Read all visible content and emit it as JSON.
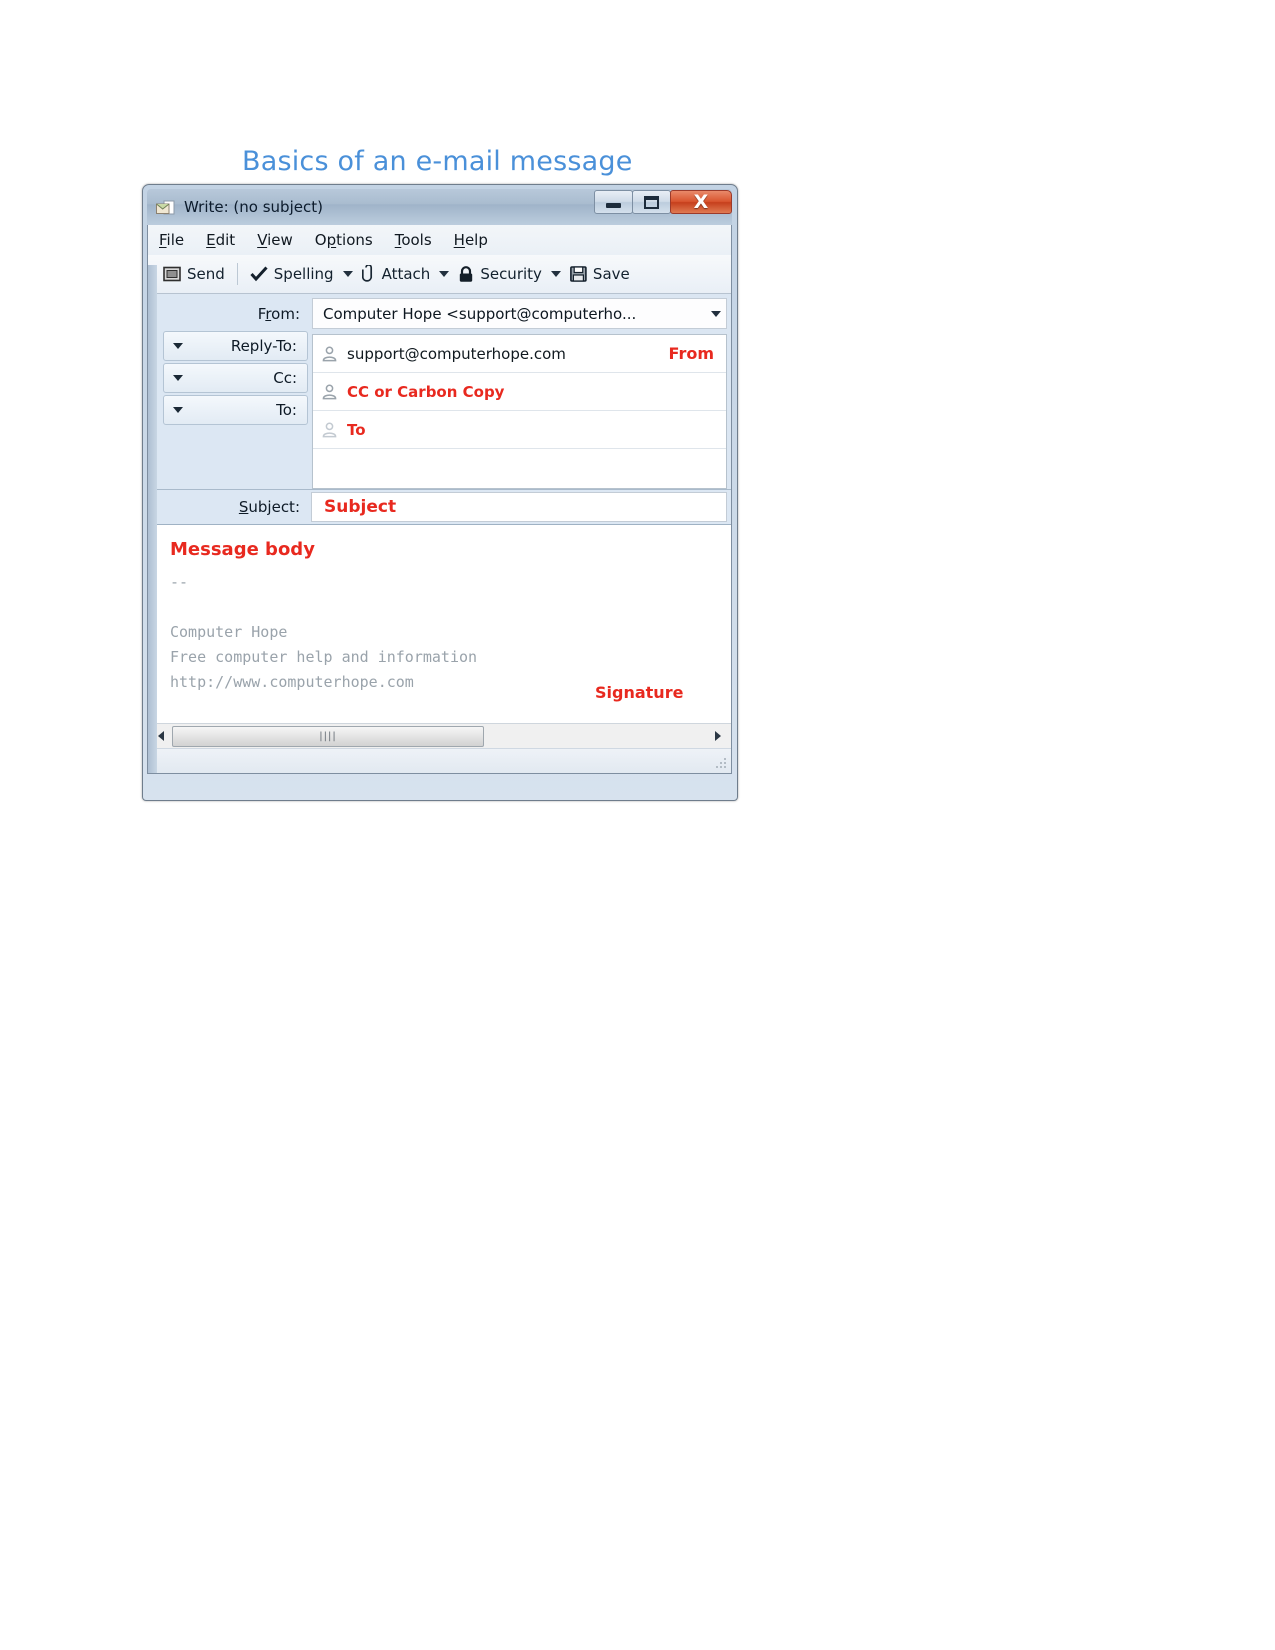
{
  "page": {
    "heading": "Basics of an e-mail message",
    "heading_color": "#4a90d9",
    "annotation_color": "#e8291f"
  },
  "window": {
    "title": "Write: (no subject)",
    "icon": "compose-mail-icon",
    "buttons": {
      "minimize": "Minimize",
      "maximize": "Maximize",
      "close": "X"
    }
  },
  "menu": {
    "items": [
      {
        "label": "File",
        "accel": "F"
      },
      {
        "label": "Edit",
        "accel": "E"
      },
      {
        "label": "View",
        "accel": "V"
      },
      {
        "label": "Options",
        "accel": "p"
      },
      {
        "label": "Tools",
        "accel": "T"
      },
      {
        "label": "Help",
        "accel": "H"
      }
    ]
  },
  "toolbar": {
    "send_label": "Send",
    "spelling_label": "Spelling",
    "attach_label": "Attach",
    "security_label": "Security",
    "save_label": "Save"
  },
  "headers": {
    "from_label": "From:",
    "from_value": "Computer Hope <support@computerho...",
    "reply_to_label": "Reply-To:",
    "cc_label": "Cc:",
    "to_label": "To:",
    "subject_label": "Subject:",
    "subject_value": "Subject",
    "rows": [
      {
        "value": "support@computerhope.com",
        "annotated": false,
        "annotation": "From"
      },
      {
        "value": "CC or Carbon Copy",
        "annotated": true,
        "annotation": ""
      },
      {
        "value": "To",
        "annotated": true,
        "annotation": ""
      }
    ]
  },
  "body": {
    "annotation": "Message body",
    "signature_delimiter": "--",
    "signature_lines": [
      "Computer Hope",
      "Free computer help and information",
      "http://www.computerhope.com"
    ],
    "signature_annotation": "Signature"
  },
  "scrollbar": {
    "left_arrow": "left-arrow-icon",
    "right_arrow": "right-arrow-icon",
    "thumb_grip": "||||"
  }
}
